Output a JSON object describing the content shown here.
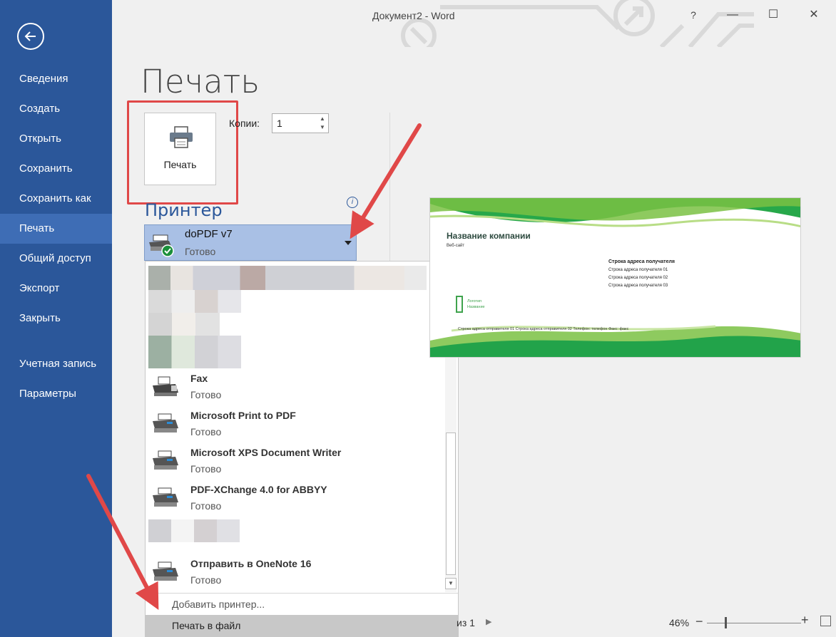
{
  "window": {
    "title": "Документ2 - Word",
    "help": "?",
    "minimize": "—",
    "maximize": "☐",
    "close": "✕"
  },
  "sidebar": {
    "items": [
      {
        "label": "Сведения"
      },
      {
        "label": "Создать"
      },
      {
        "label": "Открыть"
      },
      {
        "label": "Сохранить"
      },
      {
        "label": "Сохранить как"
      },
      {
        "label": "Печать"
      },
      {
        "label": "Общий доступ"
      },
      {
        "label": "Экспорт"
      },
      {
        "label": "Закрыть"
      },
      {
        "label": "Учетная запись"
      },
      {
        "label": "Параметры"
      }
    ],
    "active_index": 5
  },
  "main": {
    "title": "Печать",
    "print_button": "Печать",
    "copies_label": "Копии:",
    "copies_value": "1",
    "printer_section": "Принтер",
    "info_glyph": "i",
    "selected_printer": {
      "name": "doPDF v7",
      "status": "Готово"
    },
    "printers": [
      {
        "name": "Fax",
        "status": "Готово"
      },
      {
        "name": "Microsoft Print to PDF",
        "status": "Готово"
      },
      {
        "name": "Microsoft XPS Document Writer",
        "status": "Готово"
      },
      {
        "name": "PDF-XChange 4.0 for ABBYY",
        "status": "Готово"
      },
      {
        "name": "Отправить в OneNote 16",
        "status": "Готово"
      }
    ],
    "add_printer": "Добавить принтер...",
    "print_to_file": "Печать в файл"
  },
  "preview": {
    "company": "Название компании",
    "website": "Веб-сайт",
    "recipient_heading": "Строка адреса получателя",
    "recipient_lines": [
      "Строка адреса получателя 01",
      "Строка адреса получателя 02",
      "Строка адреса получателя 03"
    ],
    "logo_line1": "Логотип",
    "logo_line2": "Название",
    "footer": "Строка адреса отправителя 01 Строка адреса отправителя 02 Телефон: телефон Факс: факс"
  },
  "statusbar": {
    "page": "из 1",
    "zoom": "46%",
    "zoom_level": 0.46
  },
  "colors": {
    "sidebar": "#2b579a",
    "sidebar_active": "#3e6db5",
    "annotation": "#e04848",
    "preview_green": "#22a34a"
  }
}
